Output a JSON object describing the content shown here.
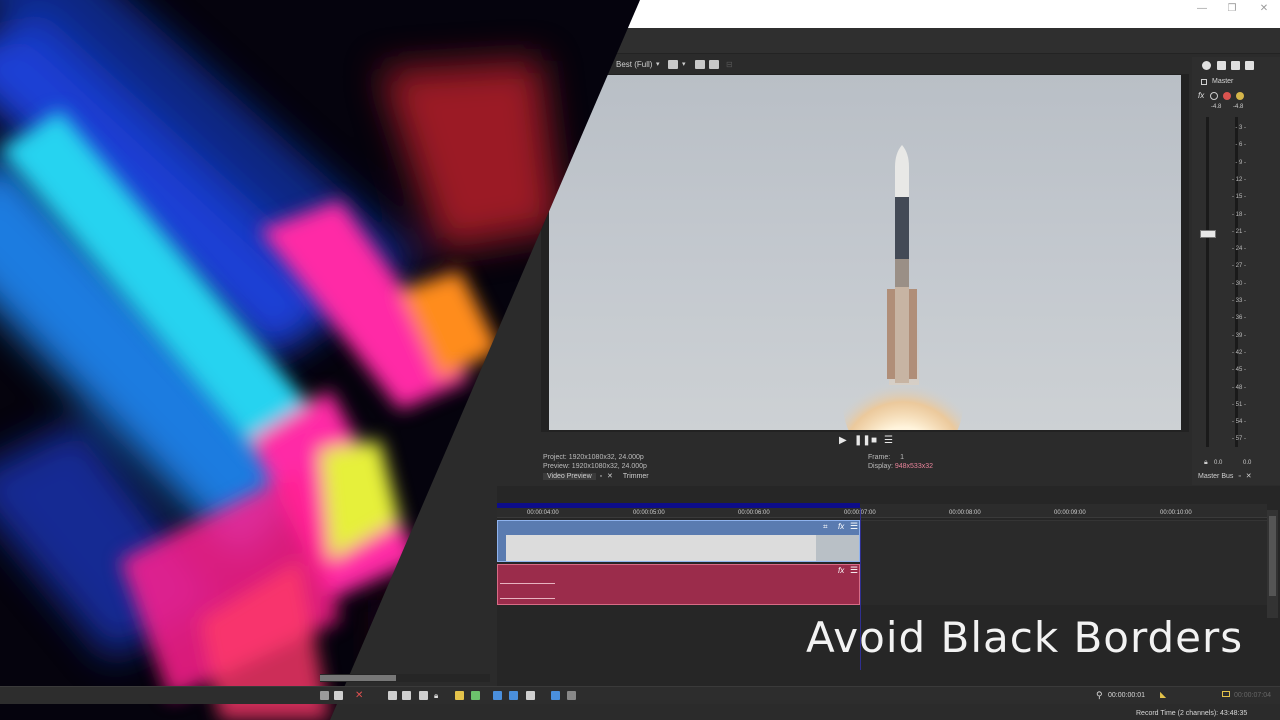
{
  "window": {
    "minimize": "—",
    "restore": "❐",
    "close": "✕"
  },
  "preview_toolbar": {
    "quality": "Best (Full)"
  },
  "preview": {
    "project_label": "Project:",
    "project_value": "1920x1080x32, 24.000p",
    "preview_label": "Preview:",
    "preview_value": "1920x1080x32, 24.000p",
    "frame_label": "Frame:",
    "frame_value": "1",
    "display_label": "Display:",
    "display_value": "948x533x32"
  },
  "tabs": {
    "video_preview": "Video Preview",
    "trimmer": "Trimmer",
    "master_bus": "Master Bus"
  },
  "master": {
    "label": "Master",
    "peak_left": "-4.8",
    "peak_right": "-4.8",
    "ticks": [
      "3",
      "6",
      "9",
      "12",
      "15",
      "18",
      "21",
      "24",
      "27",
      "30",
      "33",
      "36",
      "39",
      "42",
      "45",
      "48",
      "51",
      "54",
      "57"
    ],
    "level_left": "0.0",
    "level_right": "0.0"
  },
  "ruler": {
    "labels": [
      "00:00:04:00",
      "00:00:05:00",
      "00:00:06:00",
      "00:00:07:00",
      "00:00:08:00",
      "00:00:09:00",
      "00:00:10:00"
    ]
  },
  "overlay": {
    "caption": "Avoid Black Borders"
  },
  "bottom": {
    "timecode": "00:00:00:01",
    "end_timecode": "00:00:07:04",
    "record_time": "Record Time (2 channels): 43:48:35"
  },
  "colors": {
    "video_track": "#5a7bb0",
    "audio_track": "#9b2c4b",
    "accent": "#4a8fdc"
  }
}
